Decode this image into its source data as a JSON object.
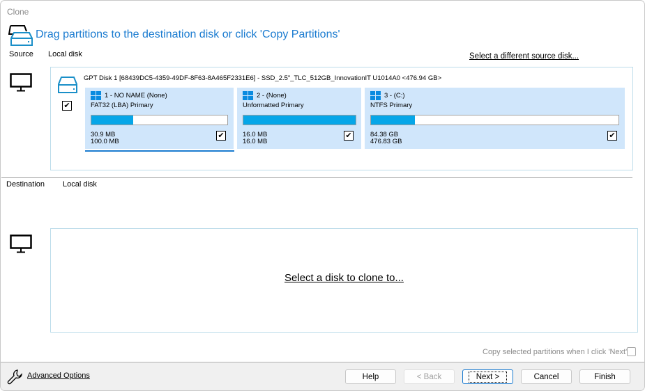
{
  "window": {
    "title": "Clone"
  },
  "header": {
    "instruction": "Drag partitions to the destination disk or click 'Copy Partitions'",
    "icon": "disk-clone-icon"
  },
  "colors": {
    "accent": "#1a7bd0",
    "usage_bar": "#06a6e8",
    "partition_bg": "#d0e6fb",
    "box_border": "#bcdcea"
  },
  "source": {
    "label": "Source",
    "type": "Local disk",
    "change_link": "Select a different source disk...",
    "disk_checked": true,
    "disk_title": "GPT Disk 1 [68439DC5-4359-49DF-8F63-8A465F2331E6] - SSD_2.5\"_TLC_512GB_InnovationIT U1014A0  <476.94 GB>",
    "partitions": [
      {
        "name": "1 - NO NAME (None)",
        "fs": "FAT32 (LBA) Primary",
        "used": "30.9 MB",
        "total": "100.0 MB",
        "usage_fraction": 0.31,
        "checked": true,
        "selected": true
      },
      {
        "name": "2 -  (None)",
        "fs": "Unformatted Primary",
        "used": "16.0 MB",
        "total": "16.0 MB",
        "usage_fraction": 1.0,
        "checked": true,
        "selected": false
      },
      {
        "name": "3 -  (C:)",
        "fs": "NTFS Primary",
        "used": "84.38 GB",
        "total": "476.83 GB",
        "usage_fraction": 0.177,
        "checked": true,
        "selected": false
      }
    ]
  },
  "destination": {
    "label": "Destination",
    "type": "Local disk",
    "select_link": "Select a disk to clone to..."
  },
  "copy_option": {
    "label": "Copy selected partitions when I click 'Next'",
    "checked": false
  },
  "footer": {
    "advanced_options": "Advanced Options",
    "buttons": {
      "help": "Help",
      "back": "< Back",
      "next": "Next >",
      "cancel": "Cancel",
      "finish": "Finish"
    }
  }
}
